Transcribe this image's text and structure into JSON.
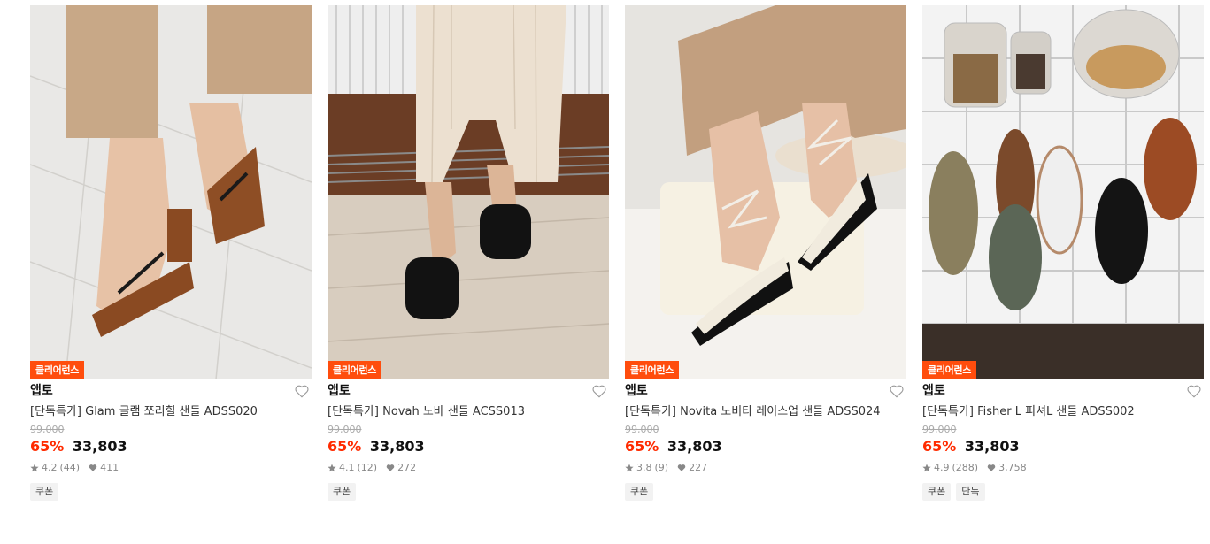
{
  "colors": {
    "badge": "#ff4d0d",
    "discount": "#ff2b00",
    "accent_text": "#111111"
  },
  "products": [
    {
      "badge": "클리어런스",
      "brand": "앱토",
      "name": "[단독특가] Glam 글램 쪼리힐 샌들 ADSS020",
      "original_price": "99,000",
      "discount": "65%",
      "price": "33,803",
      "rating": "4.2",
      "reviews": "(44)",
      "likes": "411",
      "tags": [
        "쿠폰"
      ],
      "image_icon": "sandal-photo"
    },
    {
      "badge": "클리어런스",
      "brand": "앱토",
      "name": "[단독특가] Novah 노바 샌들 ACSS013",
      "original_price": "99,000",
      "discount": "65%",
      "price": "33,803",
      "rating": "4.1",
      "reviews": "(12)",
      "likes": "272",
      "tags": [
        "쿠폰"
      ],
      "image_icon": "sandal-photo"
    },
    {
      "badge": "클리어런스",
      "brand": "앱토",
      "name": "[단독특가] Novita 노비타 레이스업 샌들 ADSS024",
      "original_price": "99,000",
      "discount": "65%",
      "price": "33,803",
      "rating": "3.8",
      "reviews": "(9)",
      "likes": "227",
      "tags": [
        "쿠폰"
      ],
      "image_icon": "sandal-photo"
    },
    {
      "badge": "클리어런스",
      "brand": "앱토",
      "name": "[단독특가] Fisher L 피셔L 샌들 ADSS002",
      "original_price": "99,000",
      "discount": "65%",
      "price": "33,803",
      "rating": "4.9",
      "reviews": "(288)",
      "likes": "3,758",
      "tags": [
        "쿠폰",
        "단독"
      ],
      "image_icon": "sandal-photo"
    }
  ]
}
